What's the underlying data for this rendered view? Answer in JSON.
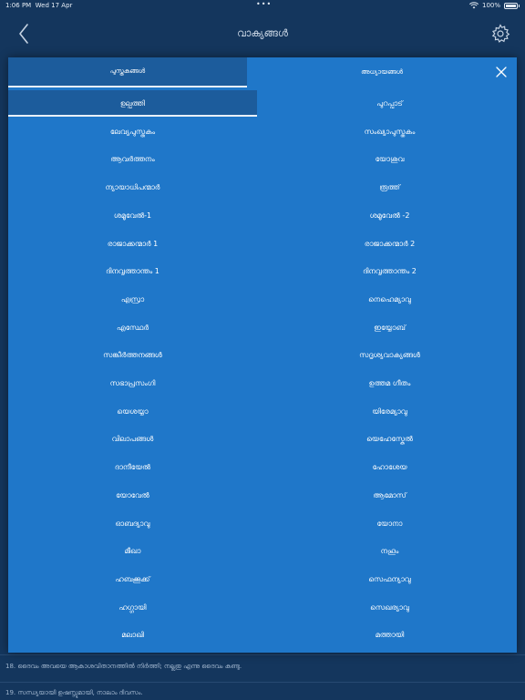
{
  "status_bar": {
    "time": "1:06 PM",
    "date": "Wed 17 Apr",
    "battery": "100%",
    "battery_level": 1.0
  },
  "nav": {
    "title": "വാക്യങ്ങൾ",
    "back_icon": "chevron-left-icon",
    "settings_icon": "gear-icon"
  },
  "modal": {
    "tab_books": "പുസ്തകങ്ങൾ",
    "tab_chapters": "അധ്യായങ്ങൾ",
    "close_icon": "close-icon",
    "selected_book": "ഉല്പത്തി",
    "books": [
      [
        "ഉല്പത്തി",
        "പുറപ്പാട്"
      ],
      [
        "ലേവ്യപുസ്തകം",
        "സംഖ്യാപുസ്തകം"
      ],
      [
        "ആവർത്തനം",
        "യോശുവ"
      ],
      [
        "ന്യായാധിപന്മാർ",
        "രൂത്ത്"
      ],
      [
        "ശമൂവേൽ-1",
        "ശമൂവേൽ -2"
      ],
      [
        "രാജാക്കന്മാർ 1",
        "രാജാക്കന്മാർ 2"
      ],
      [
        "ദിനവൃത്താന്തം 1",
        "ദിനവൃത്താന്തം 2"
      ],
      [
        "എസ്രാ",
        "നെഹെമ്യാവു"
      ],
      [
        "എസ്ഥേർ",
        "ഇയ്യോബ്"
      ],
      [
        "സങ്കീർത്തനങ്ങൾ",
        "സദൃശ്യവാക്യങ്ങൾ"
      ],
      [
        "സഭാപ്രസംഗി",
        "ഉത്തമ ഗീതം"
      ],
      [
        "യെശയ്യാ",
        "യിരേമ്യാവു"
      ],
      [
        "വിലാപങ്ങൾ",
        "യെഹേസ്കേൽ"
      ],
      [
        "ദാനീയേൽ",
        "ഹോശേയ"
      ],
      [
        "യോവേൽ",
        "ആമോസ്"
      ],
      [
        "ഓബദ്യാവു",
        "യോനാ"
      ],
      [
        "മീഖാ",
        "നഹൂം"
      ],
      [
        "ഹബക്കൂക്ക്",
        "സെഫന്യാവു"
      ],
      [
        "ഹഗ്ഗായി",
        "സെഖര്യാവു"
      ],
      [
        "മലാഖി",
        "മത്തായി"
      ]
    ]
  },
  "background": {
    "verse_18": "18. ദൈവം അവയെ ആകാശവിതാനത്തിൽ നിർത്തി; നല്ലതു എന്നു ദൈവം കണ്ടു.",
    "verse_19": "19. സന്ധ്യയായി ഉഷസ്സുമായി, നാലാം ദിവസം."
  }
}
